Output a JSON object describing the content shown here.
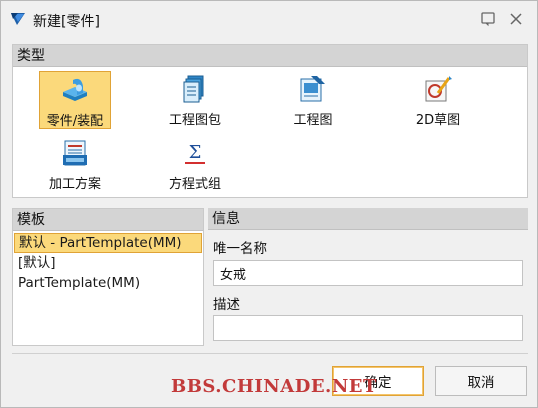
{
  "window": {
    "title": "新建[零件]",
    "icons": {
      "app": "zw3d-app-icon",
      "help": "help-icon",
      "close": "close-icon"
    }
  },
  "type_panel": {
    "header": "类型",
    "items": [
      {
        "label": "零件/装配",
        "icon": "part-assembly-icon",
        "selected": true
      },
      {
        "label": "工程图包",
        "icon": "drawing-pack-icon",
        "selected": false
      },
      {
        "label": "工程图",
        "icon": "drawing-icon",
        "selected": false
      },
      {
        "label": "2D草图",
        "icon": "2d-sketch-icon",
        "selected": false
      },
      {
        "label": "加工方案",
        "icon": "machining-plan-icon",
        "selected": false
      },
      {
        "label": "方程式组",
        "icon": "equation-set-icon",
        "selected": false
      }
    ]
  },
  "template_panel": {
    "header": "模板",
    "items": [
      {
        "label": "默认 - PartTemplate(MM)",
        "selected": true
      },
      {
        "label": "[默认]",
        "selected": false
      },
      {
        "label": "PartTemplate(MM)",
        "selected": false
      }
    ]
  },
  "info_panel": {
    "header": "信息",
    "name_label": "唯一名称",
    "name_value": "女戒",
    "desc_label": "描述",
    "desc_value": ""
  },
  "buttons": {
    "ok": "确定",
    "cancel": "取消"
  },
  "watermark": "BBS.CHINADE.NET",
  "colors": {
    "selection": "#fbd97b",
    "selection_border": "#e0a336",
    "header_bg": "#d4d4d4"
  }
}
